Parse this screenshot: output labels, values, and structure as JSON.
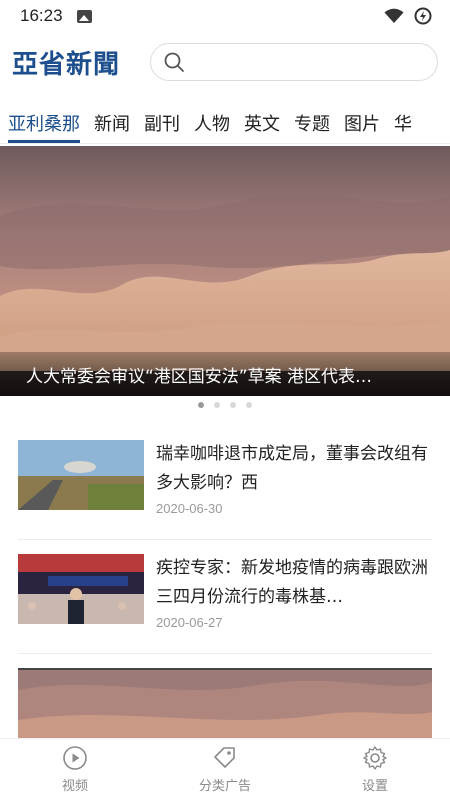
{
  "status": {
    "time": "16:23"
  },
  "header": {
    "logo": "亞省新聞",
    "search_placeholder": ""
  },
  "tabs": [
    {
      "label": "亚利桑那",
      "active": true
    },
    {
      "label": "新闻"
    },
    {
      "label": "副刊"
    },
    {
      "label": "人物"
    },
    {
      "label": "英文"
    },
    {
      "label": "专题"
    },
    {
      "label": "图片"
    },
    {
      "label": "华"
    }
  ],
  "banner": {
    "caption": "人大常委会审议“港区国安法”草案 港区代表…",
    "slide_count": 4,
    "active_slide": 1
  },
  "news": [
    {
      "title": "瑞幸咖啡退市成定局，董事会改组有多大影响？西",
      "date": "2020-06-30"
    },
    {
      "title": "疾控专家：新发地疫情的病毒跟欧洲三四月份流行的毒株基…",
      "date": "2020-06-27"
    }
  ],
  "bottom_nav": [
    {
      "label": "视频",
      "icon": "play-circle-icon"
    },
    {
      "label": "分类广告",
      "icon": "tag-icon"
    },
    {
      "label": "设置",
      "icon": "gear-icon"
    }
  ],
  "colors": {
    "brand": "#1d4f8e",
    "muted": "#8a8a8a"
  }
}
